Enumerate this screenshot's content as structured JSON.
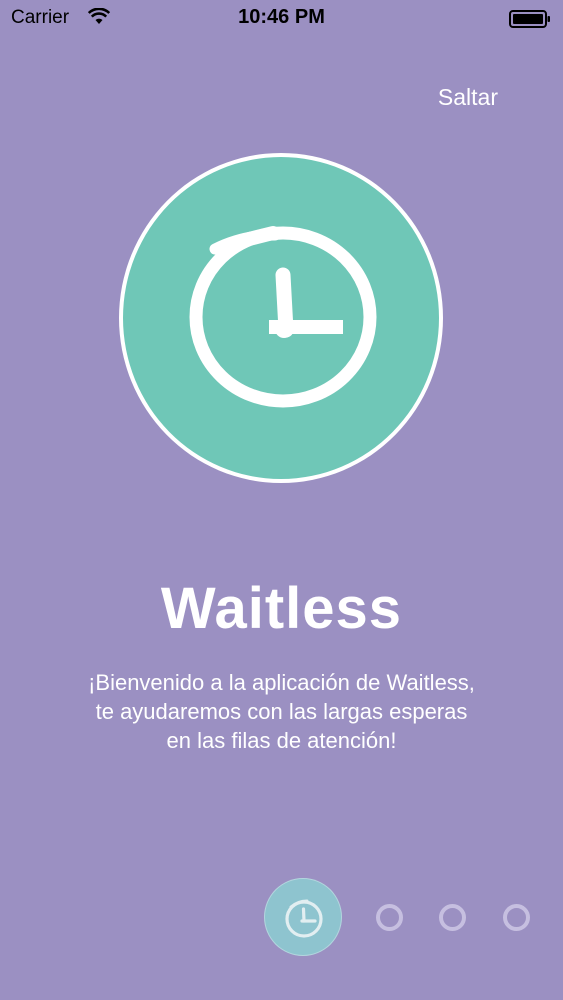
{
  "status_bar": {
    "carrier": "Carrier",
    "time": "10:46 PM",
    "wifi_icon": "wifi-icon",
    "battery_icon": "battery-icon"
  },
  "header": {
    "skip_label": "Saltar"
  },
  "hero": {
    "icon": "clock-icon",
    "circle_color": "#6fc7b7"
  },
  "content": {
    "title": "Waitless",
    "welcome_lines": [
      "¡Bienvenido a la aplicación de Waitless,",
      "te ayudaremos con las largas esperas",
      "en las filas de atención!"
    ]
  },
  "pager": {
    "active_icon": "clock-icon",
    "page_count": 4,
    "current_page": 1
  },
  "colors": {
    "background": "#9b90c2",
    "accent": "#6fc7b7",
    "text": "#ffffff"
  }
}
